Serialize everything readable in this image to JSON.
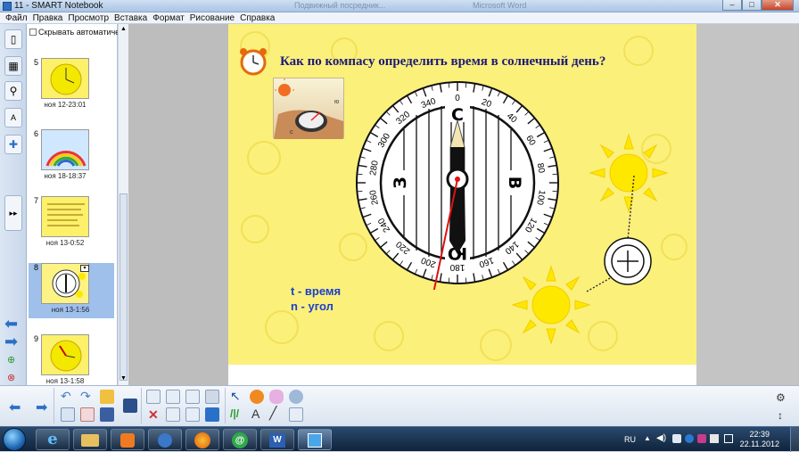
{
  "window": {
    "title": "11 - SMART Notebook",
    "ghost_titles": [
      "Подвижный посредник...",
      "Microsoft Word"
    ],
    "controls": [
      "–",
      "□",
      "✕"
    ]
  },
  "menu": [
    "Файл",
    "Правка",
    "Просмотр",
    "Вставка",
    "Формат",
    "Рисование",
    "Справка"
  ],
  "sorter": {
    "autohide_label": "Скрывать автоматическ",
    "pages": [
      {
        "num": "5",
        "label": "ноя 12-23:01"
      },
      {
        "num": "6",
        "label": "ноя 18-18:37"
      },
      {
        "num": "7",
        "label": "ноя 13-0:52"
      },
      {
        "num": "8",
        "label": "ноя 13-1:56"
      },
      {
        "num": "9",
        "label": "ноя 13-1:58"
      }
    ]
  },
  "slide": {
    "title": "Как по компасу определить время в солнечный день?",
    "legend_t": "t - время",
    "legend_n": "n - угол",
    "compass": {
      "letters": {
        "north": "С",
        "south": "Ю",
        "west": "З",
        "east": "В"
      },
      "scale_labels": [
        "0",
        "20",
        "40",
        "60",
        "80",
        "100",
        "120",
        "140",
        "160",
        "180",
        "200",
        "220",
        "240",
        "260",
        "280",
        "300",
        "320",
        "340"
      ],
      "photo_marks": [
        "ю",
        "с"
      ]
    }
  },
  "taskbar": {
    "language": "RU",
    "time": "22:39",
    "date": "22.11.2012"
  },
  "colors": {
    "slide_bg": "#fbf07a",
    "title": "#1b1a7a",
    "legend": "#1a3fd0",
    "sun": "#ffe800",
    "hand_red": "#e01010"
  }
}
